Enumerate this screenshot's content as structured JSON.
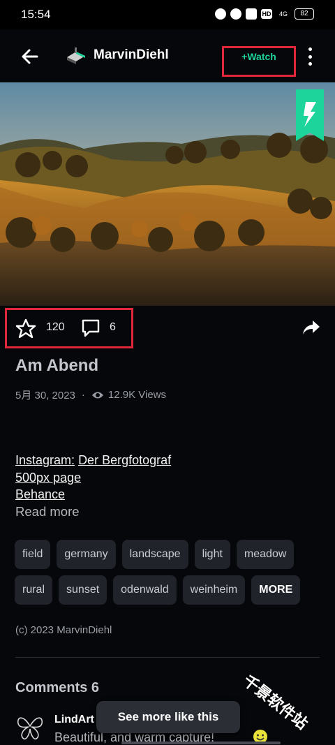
{
  "status_bar": {
    "time": "15:54",
    "network": "4G",
    "battery": "82"
  },
  "header": {
    "username": "MarvinDiehl",
    "watch_label": "+Watch"
  },
  "actions": {
    "favorites": "120",
    "comments": "6"
  },
  "deviation": {
    "title": "Am Abend",
    "date": "5月 30, 2023",
    "separator": "·",
    "views": "12.9K Views",
    "description": {
      "instagram_label": "Instagram:",
      "instagram_name": "Der Bergfotograf",
      "link_500px": "500px page",
      "link_behance": "Behance"
    },
    "read_more": "Read more",
    "tags_row1": [
      "field",
      "germany",
      "landscape",
      "light",
      "meadow"
    ],
    "tags_row2": [
      "rural",
      "sunset",
      "odenwald",
      "weinheim"
    ],
    "more_label": "MORE",
    "copyright": "(c) 2023 MarvinDiehl"
  },
  "comments": {
    "title": "Comments 6",
    "first": {
      "author": "LindArt",
      "text": "Beautiful, and warm capture!"
    }
  },
  "snackbar": {
    "label": "See more like this"
  },
  "watermark": "千景软件站",
  "colors": {
    "accent_green": "#1dd59a",
    "highlight_red": "#e0263b",
    "background": "#06070a"
  }
}
